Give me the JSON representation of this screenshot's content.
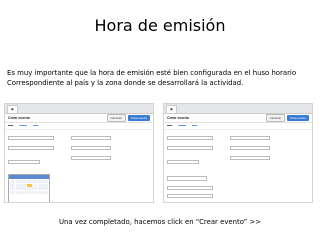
{
  "slide": {
    "title": "Hora de emisión",
    "intro_line1": "Es muy importante que la hora de emisión esté bien configurada en el huso horario",
    "intro_line2": "Correspondiente al país y la zona donde se desarrollará la actividad.",
    "footer": "Una vez completado, hacemos click en “Crear evento” >>"
  },
  "screens": {
    "left": {
      "header_title": "Crear evento",
      "cancel_label": "Cancelar",
      "create_label": "Crear evento"
    },
    "right": {
      "header_title": "Crear evento",
      "cancel_label": "Cancelar",
      "create_label": "Crear evento"
    }
  }
}
